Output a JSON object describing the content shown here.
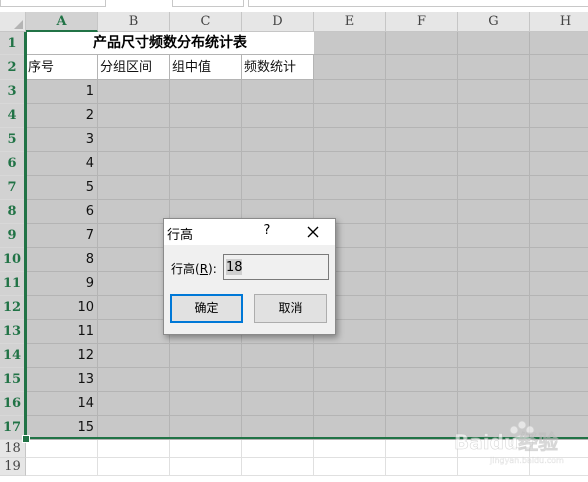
{
  "columns": [
    "A",
    "B",
    "C",
    "D",
    "E",
    "F",
    "G",
    "H"
  ],
  "rows": [
    "1",
    "2",
    "3",
    "4",
    "5",
    "6",
    "7",
    "8",
    "9",
    "10",
    "11",
    "12",
    "13",
    "14",
    "15",
    "16",
    "17",
    "18",
    "19"
  ],
  "sheet": {
    "title": "产品尺寸频数分布统计表",
    "headers": [
      "序号",
      "分组区间",
      "组中值",
      "频数统计"
    ],
    "seq": [
      "1",
      "2",
      "3",
      "4",
      "5",
      "6",
      "7",
      "8",
      "9",
      "10",
      "11",
      "12",
      "13",
      "14",
      "15"
    ]
  },
  "dialog": {
    "title": "行高",
    "help": "?",
    "label_pre": "行高(",
    "label_key": "R",
    "label_post": "):",
    "value": "18",
    "ok": "确定",
    "cancel": "取消"
  },
  "watermark": {
    "text": "Baidu经验",
    "sub": "jingyan.baidu.com"
  },
  "colors": {
    "selection": "#217346",
    "cell_fill": "#c8c8c8",
    "focus": "#0078d7"
  }
}
